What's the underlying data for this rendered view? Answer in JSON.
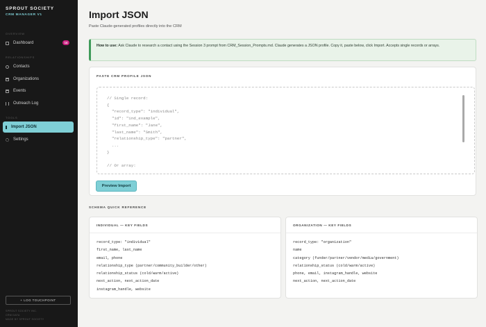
{
  "sidebar": {
    "brand_title": "SPROUT SOCIETY",
    "brand_sub": "CRM MANAGER V1",
    "sections": {
      "overview": "OVERVIEW",
      "relationships": "RELATIONSHIPS",
      "tools": "TOOLS"
    },
    "items": {
      "dashboard": {
        "label": "Dashboard",
        "badge": "14"
      },
      "contacts": {
        "label": "Contacts"
      },
      "organizations": {
        "label": "Organizations"
      },
      "events": {
        "label": "Events"
      },
      "outreach_log": {
        "label": "Outreach Log"
      },
      "import_json": {
        "label": "Import JSON"
      },
      "settings": {
        "label": "Settings"
      }
    },
    "log_touchpoint": "+ LOG TOUCHPOINT",
    "footer": [
      "SPROUT SOCIETY INC.",
      "CRM DATA",
      "MADE BY SPROUT SOCIETY"
    ]
  },
  "main": {
    "title": "Import JSON",
    "subtitle": "Paste Claude-generated profiles directly into the CRM",
    "info": {
      "bold": "How to use:",
      "text": " Ask Claude to research a contact using the Session 3 prompt from CRM_Session_Prompts.md. Claude generates a JSON profile. Copy it, paste below, click Import. Accepts single records or arrays."
    },
    "paste_card": {
      "label": "PASTE CRM PROFILE JSON",
      "placeholder": "// Single record:\n{\n  \"record_type\": \"individual\",\n  \"id\": \"ind_example\",\n  \"first_name\": \"Jane\",\n  \"last_name\": \"Smith\",\n  \"relationship_type\": \"partner\",\n  ...\n}\n\n// Or array:"
    },
    "preview_button": "Preview Import",
    "schema": {
      "heading": "SCHEMA QUICK REFERENCE",
      "individual": {
        "title": "INDIVIDUAL — KEY FIELDS",
        "lines": [
          "record_type: \"individual\"",
          "first_name, last_name",
          "email, phone",
          "relationship_type (partner/community_builder/other)",
          "relationship_status (cold/warm/active)",
          "next_action, next_action_date",
          "instagram_handle, website"
        ]
      },
      "organization": {
        "title": "ORGANIZATION — KEY FIELDS",
        "lines": [
          "record_type: \"organization\"",
          "name",
          "category (funder/partner/vendor/media/government)",
          "relationship_status (cold/warm/active)",
          "phone, email, instagram_handle, website",
          "next_action, next_action_date"
        ]
      }
    }
  },
  "colors": {
    "accent": "#7fcfd6",
    "badge": "#c9207f",
    "sidebar_bg": "#181818",
    "info_bg": "#e9f3e9"
  },
  "icons": [
    "grid-icon",
    "person-icon",
    "building-icon",
    "calendar-icon",
    "log-icon",
    "import-icon",
    "gear-icon"
  ]
}
